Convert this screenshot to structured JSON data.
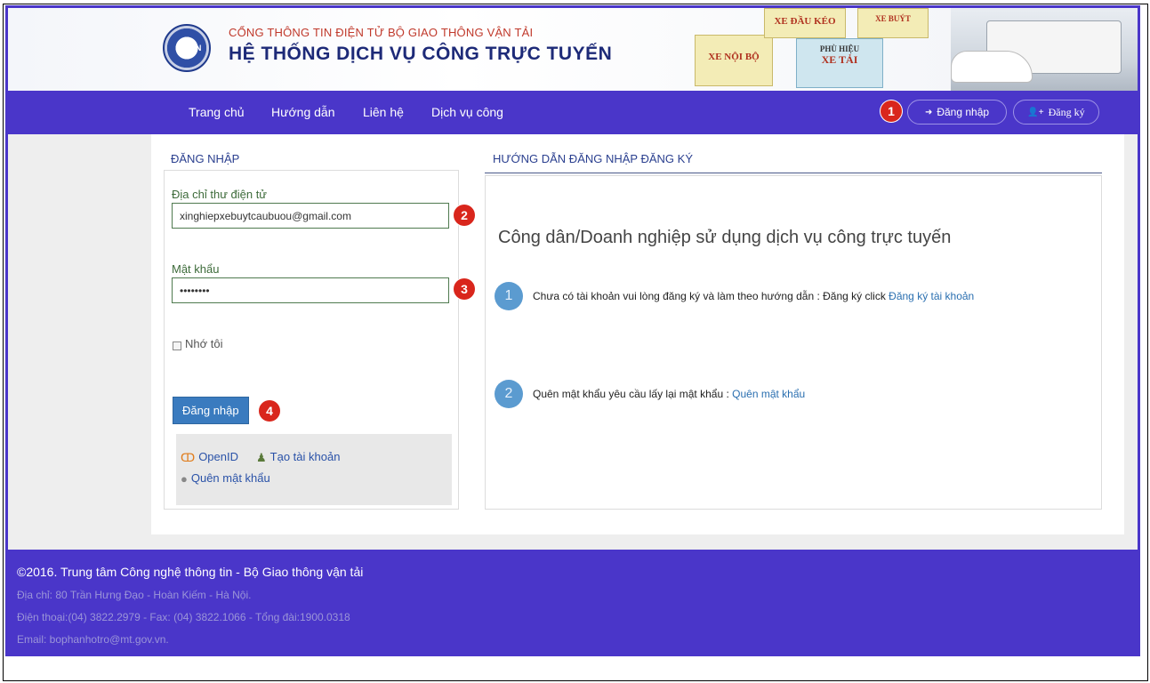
{
  "header": {
    "sub_title": "CỔNG THÔNG TIN ĐIỆN TỬ BỘ GIAO THÔNG VẬN TẢI",
    "main_title": "HỆ THỐNG DỊCH VỤ CÔNG TRỰC TUYẾN",
    "logo_text": "DRVN",
    "banner_cards": [
      "XE ĐẦU KÉO",
      "XE BUÝT",
      "XE NỘI BỘ",
      "PHÙ HIỆU",
      "XE TẢI"
    ]
  },
  "nav": {
    "items": [
      "Trang chủ",
      "Hướng dẫn",
      "Liên hệ",
      "Dịch vụ công"
    ],
    "login_label": "Đăng nhập",
    "register_label": "Đăng ký",
    "login_icon": "sign-in-icon",
    "register_icon": "user-plus-icon"
  },
  "markers": [
    "1",
    "2",
    "3",
    "4"
  ],
  "login": {
    "title": "ĐĂNG NHẬP",
    "email_label": "Địa chỉ thư điện tử",
    "email_value": "xinghiepxebuytcaubuou@gmail.com",
    "password_label": "Mật khẩu",
    "password_value": "••••••••",
    "remember_label": "Nhớ tôi",
    "submit_label": "Đăng nhập",
    "openid_label": "OpenID",
    "create_account_label": "Tạo tài khoản",
    "forgot_label": "Quên mật khẩu"
  },
  "guide": {
    "title": "HƯỚNG DẪN ĐĂNG NHẬP ĐĂNG KÝ",
    "heading": "Công dân/Doanh nghiệp sử dụng dịch vụ công trực tuyến",
    "steps": [
      {
        "num": "1",
        "text": "Chưa có tài khoản vui lòng đăng ký và làm theo hướng dẫn : Đăng ký click",
        "link": "Đăng ký tài khoản"
      },
      {
        "num": "2",
        "text": "Quên mật khẩu  yêu cầu lấy lại mật khẩu :",
        "link": "Quên mật khẩu"
      }
    ]
  },
  "footer": {
    "copyright": "©2016. Trung tâm Công nghệ thông tin - Bộ Giao thông vận tải",
    "address": "Địa chỉ: 80 Trần Hưng Đạo - Hoàn Kiếm - Hà Nội.",
    "phone": "Điện thoại:(04) 3822.2979 - Fax: (04) 3822.1066 - Tổng đài:1900.0318",
    "email": "Email: bophanhotro@mt.gov.vn."
  },
  "colors": {
    "brand": "#4a36c9",
    "marker": "#d9261c",
    "button": "#3a7bbf",
    "step_circle": "#5b9bd0"
  }
}
